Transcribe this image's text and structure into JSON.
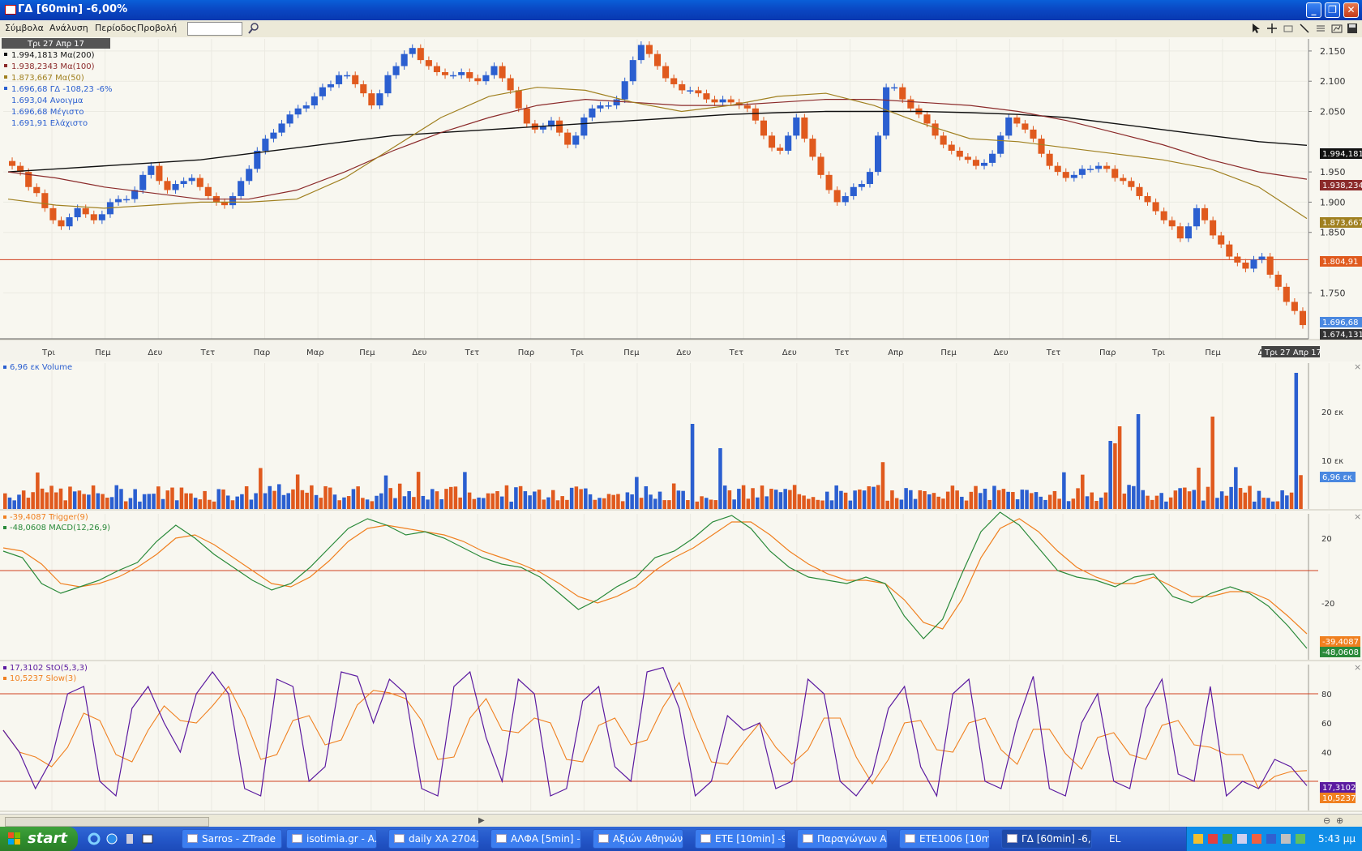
{
  "window": {
    "title": "ΓΔ [60min] -6,00%"
  },
  "menu": [
    "Σύμβολα",
    "Ανάλυση",
    "Περίοδος",
    "Προβολή"
  ],
  "colors": {
    "up": "#2b5fd0",
    "down": "#e05a1e",
    "ma200": "#111111",
    "ma100": "#8b2a2a",
    "ma50": "#a08020",
    "macd": "#2a8a3a",
    "trigger": "#f08020",
    "sto": "#5b1aa0",
    "slow": "#f08020",
    "hline": "#d04020"
  },
  "price_panel": {
    "date_header": "Τρι 27 Απρ 17",
    "legend": [
      {
        "text": "1.994,1813 Mα(200)",
        "color": "#111111"
      },
      {
        "text": "1.938,2343 Mα(100)",
        "color": "#8b2a2a"
      },
      {
        "text": "1.873,667 Mα(50)",
        "color": "#a08020"
      },
      {
        "text": "1.696,68 ΓΔ -108,23 -6%",
        "color": "#2b5fd0"
      },
      {
        "text": "1.693,04 Ανοιγμα",
        "color": "#2b5fd0"
      },
      {
        "text": "1.696,68 Μέγιστο",
        "color": "#2b5fd0"
      },
      {
        "text": "1.691,91 Ελάχιστο",
        "color": "#2b5fd0"
      }
    ],
    "y_ticks": [
      "2.150",
      "2.100",
      "2.050",
      "1.950",
      "1.900",
      "1.850",
      "1.750"
    ],
    "tags": [
      {
        "text": "1.994,181",
        "bg": "#111111"
      },
      {
        "text": "1.938,234",
        "bg": "#8b2a2a"
      },
      {
        "text": "1.873,667",
        "bg": "#a08020"
      },
      {
        "text": "1.804,91",
        "bg": "#e05a1e"
      },
      {
        "text": "1.696,68",
        "bg": "#4a88e0"
      },
      {
        "text": "1.674,131",
        "bg": "#333333"
      }
    ],
    "x_labels": [
      "Τρι",
      "Πεμ",
      "Δευ",
      "Τετ",
      "Παρ",
      "Μαρ",
      "Πεμ",
      "Δευ",
      "Τετ",
      "Παρ",
      "Τρι",
      "Πεμ",
      "Δευ",
      "Τετ",
      "Δευ",
      "Τετ",
      "Απρ",
      "Πεμ",
      "Δευ",
      "Τετ",
      "Παρ",
      "Τρι",
      "Πεμ",
      "Δε"
    ],
    "cursor_date": "Τρι 27 Απρ 17"
  },
  "volume_panel": {
    "legend": "6,96 εκ Volume",
    "y_ticks": [
      "20 εκ",
      "10 εκ"
    ],
    "tag": "6,96 εκ"
  },
  "macd_panel": {
    "legend": [
      {
        "text": "-39,4087 Trigger(9)",
        "color": "#f08020"
      },
      {
        "text": "-48,0608 MACD(12,26,9)",
        "color": "#2a8a3a"
      }
    ],
    "y_ticks": [
      "20",
      "-20"
    ],
    "tags": [
      {
        "text": "-39,4087",
        "bg": "#f08020"
      },
      {
        "text": "-48,0608",
        "bg": "#2a8a3a"
      }
    ]
  },
  "sto_panel": {
    "legend": [
      {
        "text": "17,3102 StO(5,3,3)",
        "color": "#5b1aa0"
      },
      {
        "text": "10,5237 Slow(3)",
        "color": "#f08020"
      }
    ],
    "y_ticks": [
      "80",
      "60",
      "40"
    ],
    "tags": [
      {
        "text": "17,3102",
        "bg": "#5b1aa0"
      },
      {
        "text": "10,5237",
        "bg": "#f08020"
      }
    ]
  },
  "chart_data": {
    "type": "candlestick",
    "title": "ΓΔ [60min] -6,00%",
    "ylim": [
      1674,
      2170
    ],
    "close": [
      1960,
      1950,
      1925,
      1915,
      1890,
      1870,
      1860,
      1875,
      1890,
      1880,
      1870,
      1880,
      1900,
      1905,
      1905,
      1920,
      1945,
      1960,
      1935,
      1920,
      1930,
      1935,
      1940,
      1925,
      1910,
      1900,
      1895,
      1910,
      1935,
      1955,
      1985,
      2005,
      2015,
      2030,
      2045,
      2055,
      2060,
      2075,
      2090,
      2095,
      2110,
      2110,
      2095,
      2080,
      2060,
      2080,
      2110,
      2125,
      2145,
      2155,
      2135,
      2125,
      2115,
      2110,
      2110,
      2115,
      2105,
      2100,
      2110,
      2125,
      2105,
      2085,
      2055,
      2030,
      2020,
      2025,
      2035,
      2015,
      1995,
      2010,
      2040,
      2055,
      2060,
      2060,
      2070,
      2100,
      2135,
      2160,
      2145,
      2125,
      2105,
      2095,
      2085,
      2085,
      2080,
      2070,
      2065,
      2070,
      2065,
      2060,
      2055,
      2035,
      2010,
      1990,
      1985,
      2010,
      2040,
      2005,
      1975,
      1945,
      1920,
      1900,
      1910,
      1925,
      1930,
      1950,
      2010,
      2090,
      2090,
      2070,
      2055,
      2045,
      2030,
      2010,
      1995,
      1985,
      1975,
      1970,
      1960,
      1965,
      1980,
      2010,
      2040,
      2030,
      2020,
      2005,
      1980,
      1960,
      1950,
      1940,
      1945,
      1955,
      1955,
      1960,
      1955,
      1940,
      1935,
      1925,
      1910,
      1900,
      1885,
      1870,
      1860,
      1840,
      1860,
      1890,
      1870,
      1845,
      1830,
      1810,
      1800,
      1790,
      1805,
      1810,
      1780,
      1760,
      1735,
      1720,
      1696.68
    ],
    "ma200": [
      1950,
      1955,
      1960,
      1965,
      1970,
      1980,
      1990,
      2000,
      2010,
      2015,
      2020,
      2025,
      2030,
      2035,
      2040,
      2045,
      2048,
      2050,
      2050,
      2050,
      2048,
      2045,
      2040,
      2030,
      2020,
      2010,
      2000,
      1994
    ],
    "ma100": [
      1950,
      1940,
      1925,
      1915,
      1905,
      1905,
      1920,
      1950,
      1985,
      2015,
      2040,
      2060,
      2070,
      2065,
      2060,
      2060,
      2065,
      2070,
      2070,
      2065,
      2060,
      2050,
      2035,
      2015,
      1995,
      1970,
      1950,
      1938
    ],
    "ma50": [
      1905,
      1895,
      1890,
      1895,
      1900,
      1900,
      1905,
      1940,
      1990,
      2040,
      2075,
      2090,
      2085,
      2065,
      2050,
      2060,
      2075,
      2080,
      2060,
      2030,
      2005,
      2000,
      1990,
      1980,
      1970,
      1955,
      1925,
      1873
    ],
    "hline": 1804.91,
    "volume": {
      "last": 6.96,
      "unit": "εκ",
      "ylim": [
        0,
        30
      ]
    },
    "macd": {
      "macd_last": -48.0608,
      "trigger_last": -39.4087,
      "ylim": [
        -55,
        35
      ],
      "macd": [
        12,
        8,
        -8,
        -14,
        -10,
        -6,
        0,
        5,
        18,
        28,
        20,
        10,
        2,
        -6,
        -12,
        -8,
        2,
        14,
        26,
        32,
        28,
        22,
        24,
        20,
        14,
        8,
        4,
        2,
        -4,
        -14,
        -24,
        -18,
        -10,
        -4,
        8,
        12,
        20,
        30,
        34,
        26,
        12,
        2,
        -4,
        -6,
        -8,
        -4,
        -8,
        -28,
        -42,
        -30,
        -2,
        24,
        36,
        28,
        14,
        0,
        -4,
        -6,
        -10,
        -4,
        -2,
        -16,
        -20,
        -14,
        -10,
        -14,
        -22,
        -34,
        -48
      ],
      "trigger": [
        14,
        12,
        4,
        -8,
        -10,
        -8,
        -4,
        2,
        10,
        20,
        22,
        16,
        8,
        0,
        -8,
        -10,
        -4,
        6,
        18,
        26,
        28,
        26,
        24,
        22,
        18,
        12,
        8,
        4,
        -1,
        -8,
        -16,
        -20,
        -16,
        -10,
        0,
        8,
        14,
        22,
        30,
        30,
        22,
        12,
        4,
        -2,
        -6,
        -6,
        -8,
        -18,
        -32,
        -36,
        -18,
        8,
        26,
        32,
        24,
        12,
        2,
        -4,
        -8,
        -8,
        -4,
        -10,
        -16,
        -16,
        -13,
        -13,
        -18,
        -28,
        -39
      ]
    },
    "stochastic": {
      "sto_last": 17.3102,
      "slow_last": 10.5237,
      "ylim": [
        0,
        100
      ],
      "sto": [
        55,
        40,
        15,
        35,
        80,
        85,
        20,
        10,
        70,
        85,
        60,
        40,
        80,
        95,
        80,
        15,
        10,
        90,
        85,
        20,
        30,
        95,
        92,
        60,
        90,
        80,
        15,
        10,
        85,
        95,
        50,
        20,
        90,
        80,
        10,
        15,
        75,
        85,
        30,
        20,
        95,
        98,
        70,
        10,
        20,
        65,
        55,
        60,
        15,
        20,
        90,
        80,
        20,
        10,
        25,
        70,
        85,
        30,
        10,
        80,
        90,
        20,
        15,
        60,
        92,
        15,
        10,
        60,
        80,
        20,
        15,
        70,
        90,
        25,
        20,
        85,
        10,
        20,
        15,
        35,
        30,
        17
      ]
    }
  }
}
